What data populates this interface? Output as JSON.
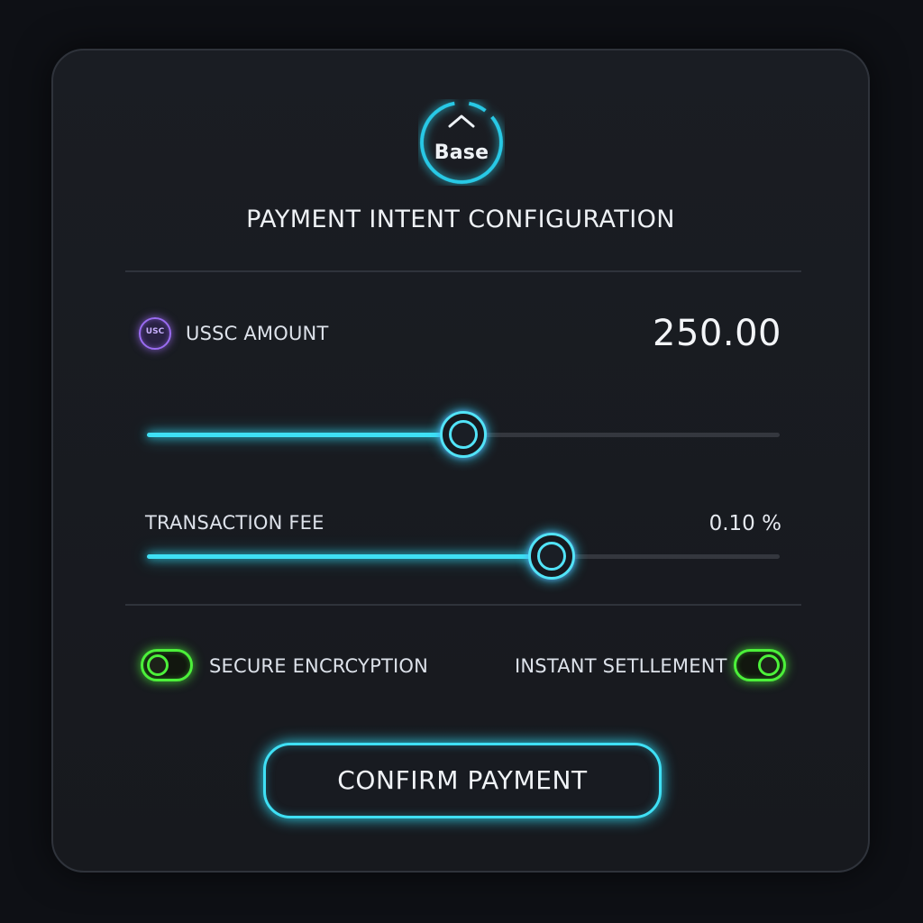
{
  "network": {
    "name": "Base",
    "icon": "chevron-up-icon",
    "accent": "#2fd5ee"
  },
  "title": "PAYMENT INTENT CONFIGURATION",
  "amount": {
    "icon_text": "USC",
    "icon": "usdc-coin-icon",
    "label": "USSC AMOUNT",
    "value": "250.00",
    "slider_percent": 50
  },
  "fee": {
    "label": "TRANSACTION FEE",
    "value": "0.10 %",
    "slider_percent": 64
  },
  "toggles": {
    "secure": {
      "label": "SECURE ENCRCYPTION",
      "on": true
    },
    "instant": {
      "label": "INSTANT SETLLEMENT",
      "on": true
    },
    "color": "#4cf03a"
  },
  "confirm_label": "CONFIRM PAYMENT",
  "colors": {
    "slider_accent": "#3fe0f5",
    "coin_accent": "#9b6cf2",
    "background": "#0e1015",
    "card": "#1a1d23"
  }
}
